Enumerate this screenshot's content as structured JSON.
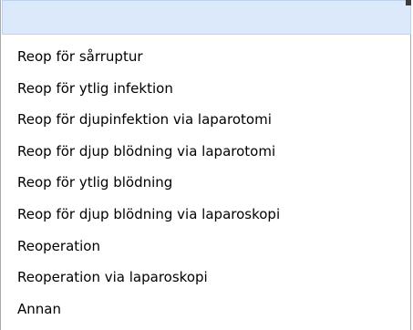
{
  "dropdown": {
    "selected_value": "",
    "options": [
      "Reop för sårruptur",
      "Reop för ytlig infektion",
      "Reop för djupinfektion via laparotomi",
      "Reop för djup blödning via laparotomi",
      "Reop för ytlig blödning",
      "Reop för djup blödning via laparoskopi",
      "Reoperation",
      "Reoperation via laparoskopi",
      "Annan"
    ]
  },
  "colors": {
    "selected_row_bg": "#dbe9fb",
    "border": "#a9a9a9",
    "text": "#000000"
  }
}
